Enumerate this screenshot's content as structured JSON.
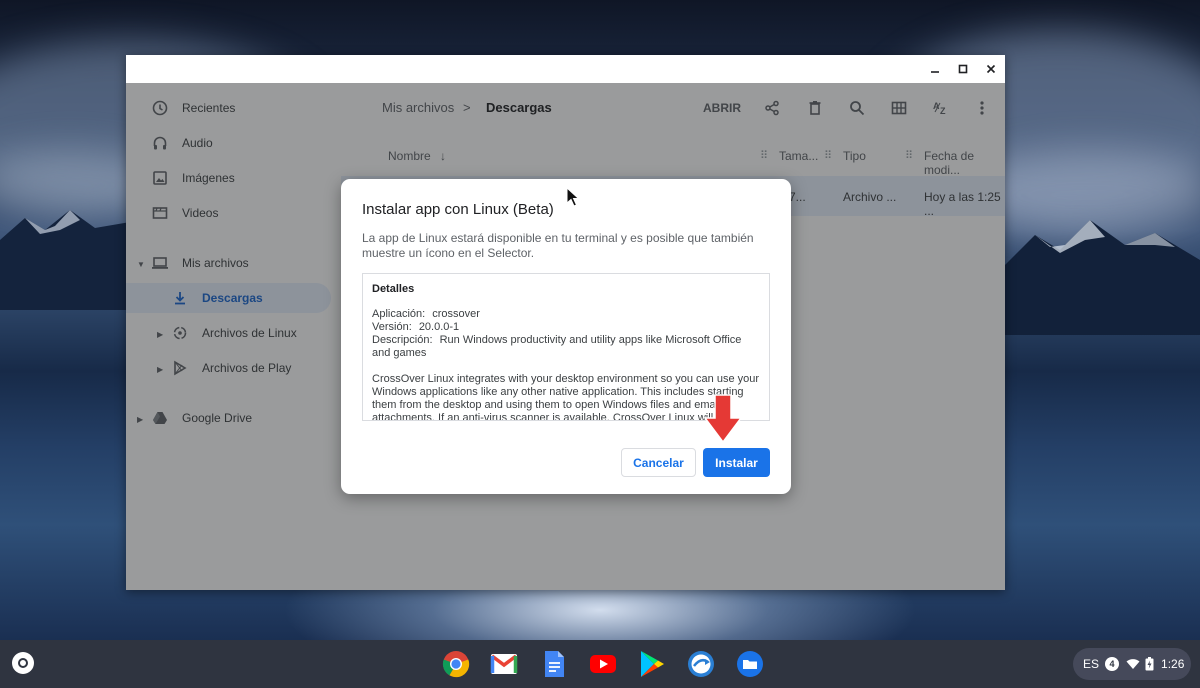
{
  "window": {
    "controls": {
      "minimize_icon": "minimize-icon",
      "maximize_icon": "maximize-icon",
      "close_icon": "close-icon"
    }
  },
  "sidebar": {
    "items": [
      {
        "label": "Recientes",
        "icon": "clock-icon"
      },
      {
        "label": "Audio",
        "icon": "headphones-icon"
      },
      {
        "label": "Imágenes",
        "icon": "image-icon"
      },
      {
        "label": "Videos",
        "icon": "video-icon"
      },
      {
        "label": "Mis archivos",
        "icon": "laptop-icon"
      },
      {
        "label": "Descargas",
        "icon": "download-icon"
      },
      {
        "label": "Archivos de Linux",
        "icon": "linux-icon"
      },
      {
        "label": "Archivos de Play",
        "icon": "play-store-icon"
      },
      {
        "label": "Google Drive",
        "icon": "drive-icon"
      }
    ]
  },
  "breadcrumb": {
    "root": "Mis archivos",
    "separator": ">",
    "current": "Descargas"
  },
  "toolbar": {
    "open_label": "ABRIR"
  },
  "columns": {
    "name": "Nombre",
    "size": "Tama...",
    "type": "Tipo",
    "date": "Fecha de modi..."
  },
  "file_row": {
    "size": "7...",
    "type": "Archivo ...",
    "date": "Hoy a las 1:25 ..."
  },
  "dialog": {
    "title": "Instalar app con Linux (Beta)",
    "description": "La app de Linux estará disponible en tu terminal y es posible que también muestre un ícono en el Selector.",
    "details": {
      "heading": "Detalles",
      "application_label": "Aplicación:",
      "application_value": "crossover",
      "version_label": "Versión:",
      "version_value": "20.0.0-1",
      "description_label": "Descripción:",
      "description_value": "Run Windows productivity and utility apps like Microsoft Office and games",
      "long_text": "CrossOver Linux integrates with your desktop environment so you can use your Windows applications like any other native application. This includes starting them from the desktop and using them to open Windows files and email attachments. If an anti-virus scanner is available, CrossOver Linux will"
    },
    "cancel_label": "Cancelar",
    "install_label": "Instalar"
  },
  "shelf": {
    "apps": [
      "chrome-icon",
      "gmail-icon",
      "docs-icon",
      "youtube-icon",
      "play-store-icon",
      "crossover-icon",
      "files-icon"
    ],
    "tray": {
      "language": "ES",
      "notifications": "4",
      "time": "1:26"
    }
  },
  "colors": {
    "accent": "#1a73e8",
    "arrow": "#e53935",
    "shelf": "#2f3440"
  }
}
